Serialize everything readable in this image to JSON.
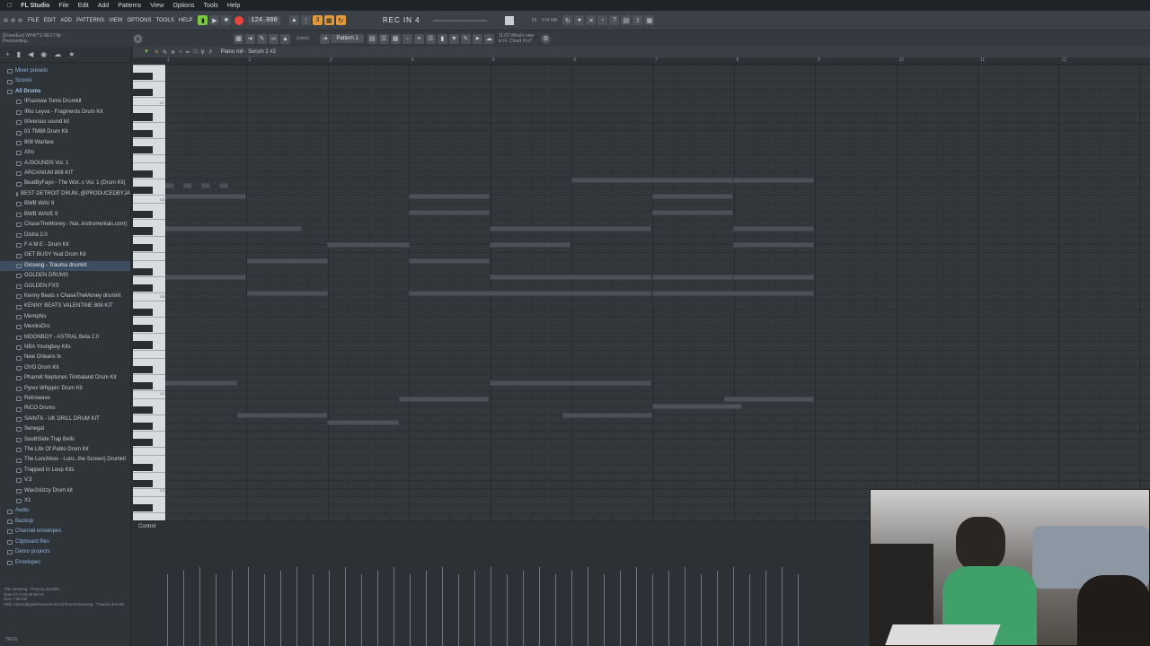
{
  "mac_menu": {
    "app": "FL Studio",
    "items": [
      "File",
      "Edit",
      "Add",
      "Patterns",
      "View",
      "Options",
      "Tools",
      "Help"
    ]
  },
  "fl_menu": [
    "FILE",
    "EDIT",
    "ADD",
    "PATTERNS",
    "VIEW",
    "OPTIONS",
    "TOOLS",
    "HELP"
  ],
  "project": {
    "title_line": "[DoverEar] WHAT'S NEXT.flp",
    "status": "Precounting..."
  },
  "transport": {
    "tempo": "124.000",
    "song_name": "REC IN 4",
    "cpu": "23",
    "memory": "574 MB"
  },
  "pattern_select": {
    "value": "Pattern 1",
    "snap": "(none)"
  },
  "news": {
    "line1": "11:03 What's new",
    "line2": "in FL Cloud Pro?"
  },
  "piano_roll": {
    "title": "Piano roll - Serum 2 #2",
    "bars": [
      "1",
      "2",
      "3",
      "4",
      "5",
      "6",
      "7",
      "8",
      "9",
      "10",
      "11",
      "12"
    ],
    "octave_labels": [
      "C7",
      "C6",
      "C5",
      "C4",
      "C3"
    ]
  },
  "browser": {
    "items": [
      {
        "label": "Mixer presets",
        "level": "top"
      },
      {
        "label": "Scores",
        "level": "top"
      },
      {
        "label": "All Drums",
        "level": "open"
      },
      {
        "label": "!Prazewa Tomo Drumkit",
        "level": "sub"
      },
      {
        "label": "!Rio Leyva - Fragments Drum Kit",
        "level": "sub"
      },
      {
        "label": "00versus sound kit",
        "level": "sub"
      },
      {
        "label": "01 TM88 Drum Kit",
        "level": "sub"
      },
      {
        "label": "808 Warfare",
        "level": "sub"
      },
      {
        "label": "Afro",
        "level": "sub"
      },
      {
        "label": "AJSOUNDS Vol. 1",
        "level": "sub"
      },
      {
        "label": "ARCANIUM 808 KIT",
        "level": "sub"
      },
      {
        "label": "BeatByFayo - The Wor..s Vol. 1 (Drum Kit)",
        "level": "sub"
      },
      {
        "label": "BEST DETROIT DRUM..@PRODUCEDBYJAVEN",
        "level": "sub"
      },
      {
        "label": "BWB WAV 8",
        "level": "sub"
      },
      {
        "label": "BWB WAVE 9",
        "level": "sub"
      },
      {
        "label": "ChaseTheMoney - Nar..instrumentals.com)",
        "level": "sub"
      },
      {
        "label": "Distra 2.0",
        "level": "sub"
      },
      {
        "label": "F A M E - Drum Kit",
        "level": "sub"
      },
      {
        "label": "GET BUSY Yeat Drum Kit",
        "level": "sub"
      },
      {
        "label": "Ginseng - Trauma drumkit",
        "level": "sub",
        "selected": true
      },
      {
        "label": "GOLDEN DRUMS",
        "level": "sub"
      },
      {
        "label": "GOLDEN FXS",
        "level": "sub"
      },
      {
        "label": "Kenny Beats x ChaseTheMoney drumkit",
        "level": "sub"
      },
      {
        "label": "KENNY BEATS VALENTINE 808 KIT",
        "level": "sub"
      },
      {
        "label": "Memphis",
        "level": "sub"
      },
      {
        "label": "MexikoDro",
        "level": "sub"
      },
      {
        "label": "MOONBOY - ASTRAL Beta 2.0",
        "level": "sub"
      },
      {
        "label": "NBA Youngboy Kits",
        "level": "sub"
      },
      {
        "label": "New Orleans fx",
        "level": "sub"
      },
      {
        "label": "OVO Drum Kit",
        "level": "sub"
      },
      {
        "label": "Pharrell Neptunes Timbaland Drum Kit",
        "level": "sub"
      },
      {
        "label": "Pyrex Whippin' Drum Kit",
        "level": "sub"
      },
      {
        "label": "Retrowave",
        "level": "sub"
      },
      {
        "label": "RICO Drums",
        "level": "sub"
      },
      {
        "label": "SAINT6 - UK DRILL DRUM KIT",
        "level": "sub"
      },
      {
        "label": "Senegal",
        "level": "sub"
      },
      {
        "label": "SouthSide Trap Bells",
        "level": "sub"
      },
      {
        "label": "The Life Of Pablo Drum Kit",
        "level": "sub"
      },
      {
        "label": "The Lunchbox - Lunc..the Screen) Drumkit",
        "level": "sub"
      },
      {
        "label": "Trapped In Loop Kits",
        "level": "sub"
      },
      {
        "label": "V.3",
        "level": "sub"
      },
      {
        "label": "Wav2slizzy Drum kit",
        "level": "sub"
      },
      {
        "label": "X1",
        "level": "sub"
      },
      {
        "label": "Audio",
        "level": "top"
      },
      {
        "label": "Backup",
        "level": "top"
      },
      {
        "label": "Channel envelopes",
        "level": "top"
      },
      {
        "label": "Clipboard files",
        "level": "top"
      },
      {
        "label": "Demo projects",
        "level": "top"
      },
      {
        "label": "Envelopes",
        "level": "top"
      }
    ],
    "info": {
      "title": "Title   Ginseng - Trauma drumkit",
      "date": "Date    2?-3-26 02:50:21",
      "size": "Size    7.69 KB",
      "path": "Path    /Users/digital/Documents/All Drums/Ginseng - Trauma drumkit"
    },
    "tags_label": "TAGS"
  },
  "control": {
    "label": "Control"
  },
  "colors": {
    "accent": "#e09a3b",
    "record": "#e8443b",
    "note": "#4a5158"
  }
}
